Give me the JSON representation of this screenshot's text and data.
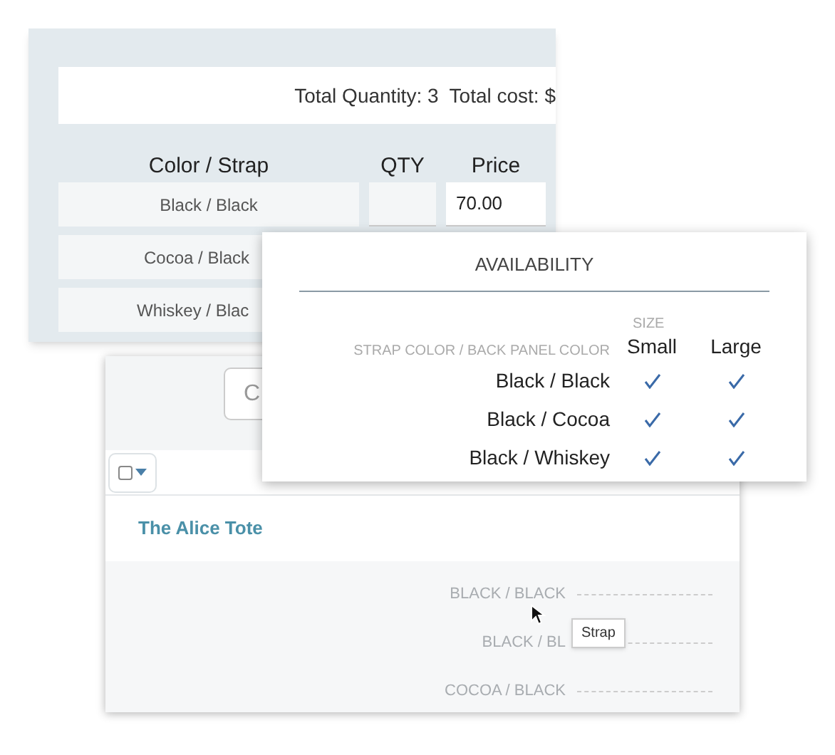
{
  "order_card": {
    "totals": "Total Quantity: 3  Total cost: $",
    "columns": [
      "Color / Strap",
      "QTY",
      "Price"
    ],
    "rows": [
      {
        "color_strap": "Black / Black",
        "price": "70.00"
      },
      {
        "color_strap": "Cocoa / Black"
      },
      {
        "color_strap": "Whiskey / Blac"
      }
    ]
  },
  "product_card": {
    "toolbar_button": "C",
    "select_checkbox": {
      "checked": false
    },
    "product_name": "The Alice Tote",
    "variants": [
      "BLACK / BLACK",
      "BLACK / BL",
      "COCOA / BLACK"
    ],
    "tooltip": "Strap"
  },
  "availability_popup": {
    "title": "AVAILABILITY",
    "size_heading": "SIZE",
    "row_heading": "STRAP COLOR / BACK PANEL COLOR",
    "sizes": [
      "Small",
      "Large"
    ],
    "rows": [
      {
        "label": "Black / Black",
        "available": [
          true,
          true
        ]
      },
      {
        "label": "Black / Cocoa",
        "available": [
          true,
          true
        ]
      },
      {
        "label": "Black / Whiskey",
        "available": [
          true,
          true
        ]
      }
    ]
  }
}
